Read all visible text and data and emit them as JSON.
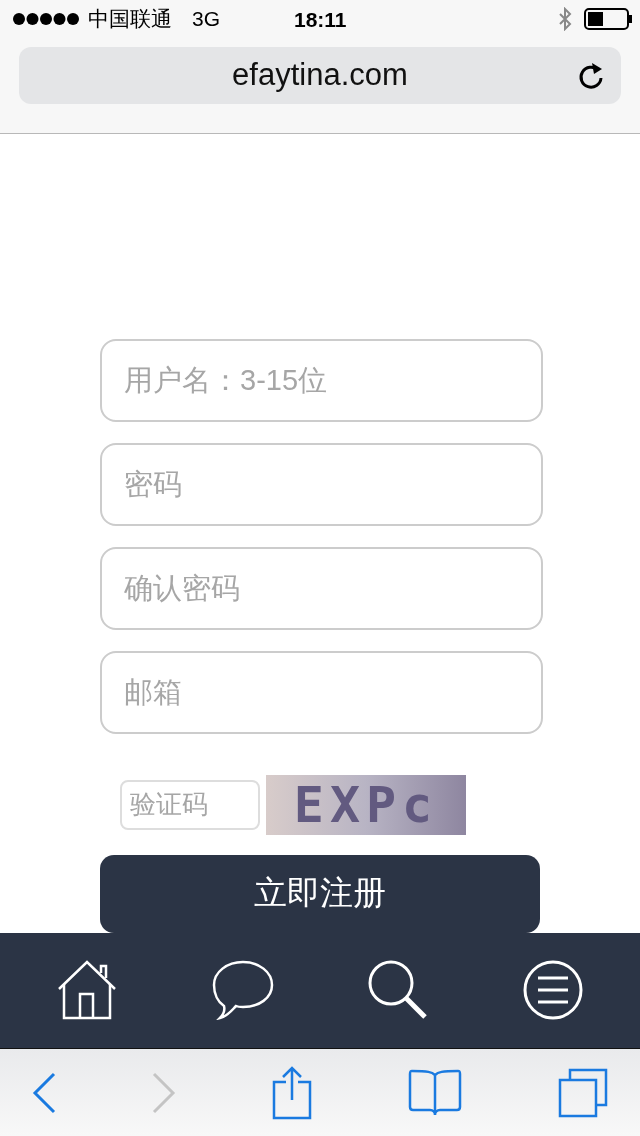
{
  "status_bar": {
    "carrier": "中国联通",
    "network": "3G",
    "time": "18:11"
  },
  "address_bar": {
    "url": "efaytina.com"
  },
  "form": {
    "fields": [
      {
        "placeholder": "用户名：3-15位"
      },
      {
        "placeholder": "密码"
      },
      {
        "placeholder": "确认密码"
      },
      {
        "placeholder": "邮箱"
      }
    ],
    "captcha": {
      "placeholder": "验证码",
      "image_text": "EXPc"
    },
    "submit": "立即注册"
  },
  "nav_bar": [
    {
      "kind": "home"
    },
    {
      "kind": "chat"
    },
    {
      "kind": "search"
    },
    {
      "kind": "menu"
    }
  ],
  "toolbar": [
    {
      "kind": "back",
      "disabled": false
    },
    {
      "kind": "forward",
      "disabled": true
    },
    {
      "kind": "share",
      "disabled": false
    },
    {
      "kind": "bookmarks",
      "disabled": false
    },
    {
      "kind": "tabs",
      "disabled": false
    }
  ]
}
